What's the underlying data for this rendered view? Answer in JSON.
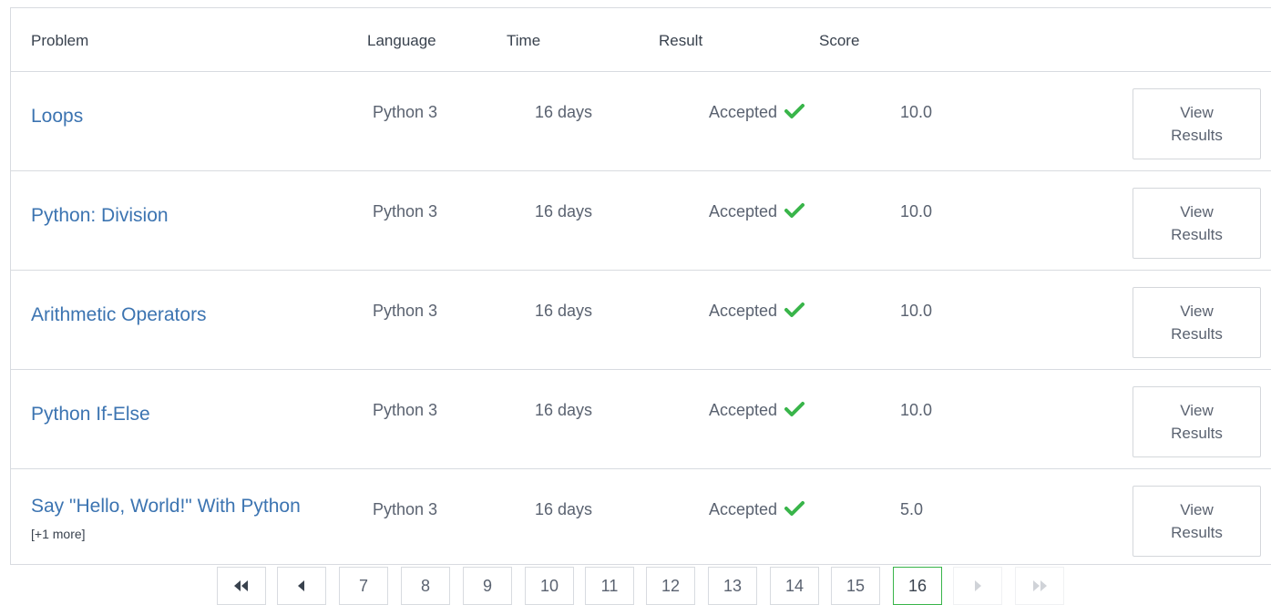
{
  "header": {
    "problem": "Problem",
    "language": "Language",
    "time": "Time",
    "result": "Result",
    "score": "Score"
  },
  "rows": [
    {
      "problem": "Loops",
      "extra": "",
      "language": "Python 3",
      "time": "16 days",
      "result": "Accepted",
      "score": "10.0",
      "button_line1": "View",
      "button_line2": "Results"
    },
    {
      "problem": "Python: Division",
      "extra": "",
      "language": "Python 3",
      "time": "16 days",
      "result": "Accepted",
      "score": "10.0",
      "button_line1": "View",
      "button_line2": "Results"
    },
    {
      "problem": "Arithmetic Operators",
      "extra": "",
      "language": "Python 3",
      "time": "16 days",
      "result": "Accepted",
      "score": "10.0",
      "button_line1": "View",
      "button_line2": "Results"
    },
    {
      "problem": "Python If-Else",
      "extra": "",
      "language": "Python 3",
      "time": "16 days",
      "result": "Accepted",
      "score": "10.0",
      "button_line1": "View",
      "button_line2": "Results"
    },
    {
      "problem": "Say \"Hello, World!\" With Python",
      "extra": "[+1 more]",
      "language": "Python 3",
      "time": "16 days",
      "result": "Accepted",
      "score": "5.0",
      "button_line1": "View",
      "button_line2": "Results"
    }
  ],
  "pagination": {
    "first_icon": "double-chevron-left-icon",
    "prev_icon": "chevron-left-icon",
    "pages": [
      "7",
      "8",
      "9",
      "10",
      "11",
      "12",
      "13",
      "14",
      "15",
      "16"
    ],
    "current": "16",
    "next_icon": "chevron-right-icon",
    "last_icon": "double-chevron-right-icon"
  },
  "colors": {
    "link": "#3c74b1",
    "accepted_check": "#39b54a",
    "active_page_border": "#39b54a"
  }
}
